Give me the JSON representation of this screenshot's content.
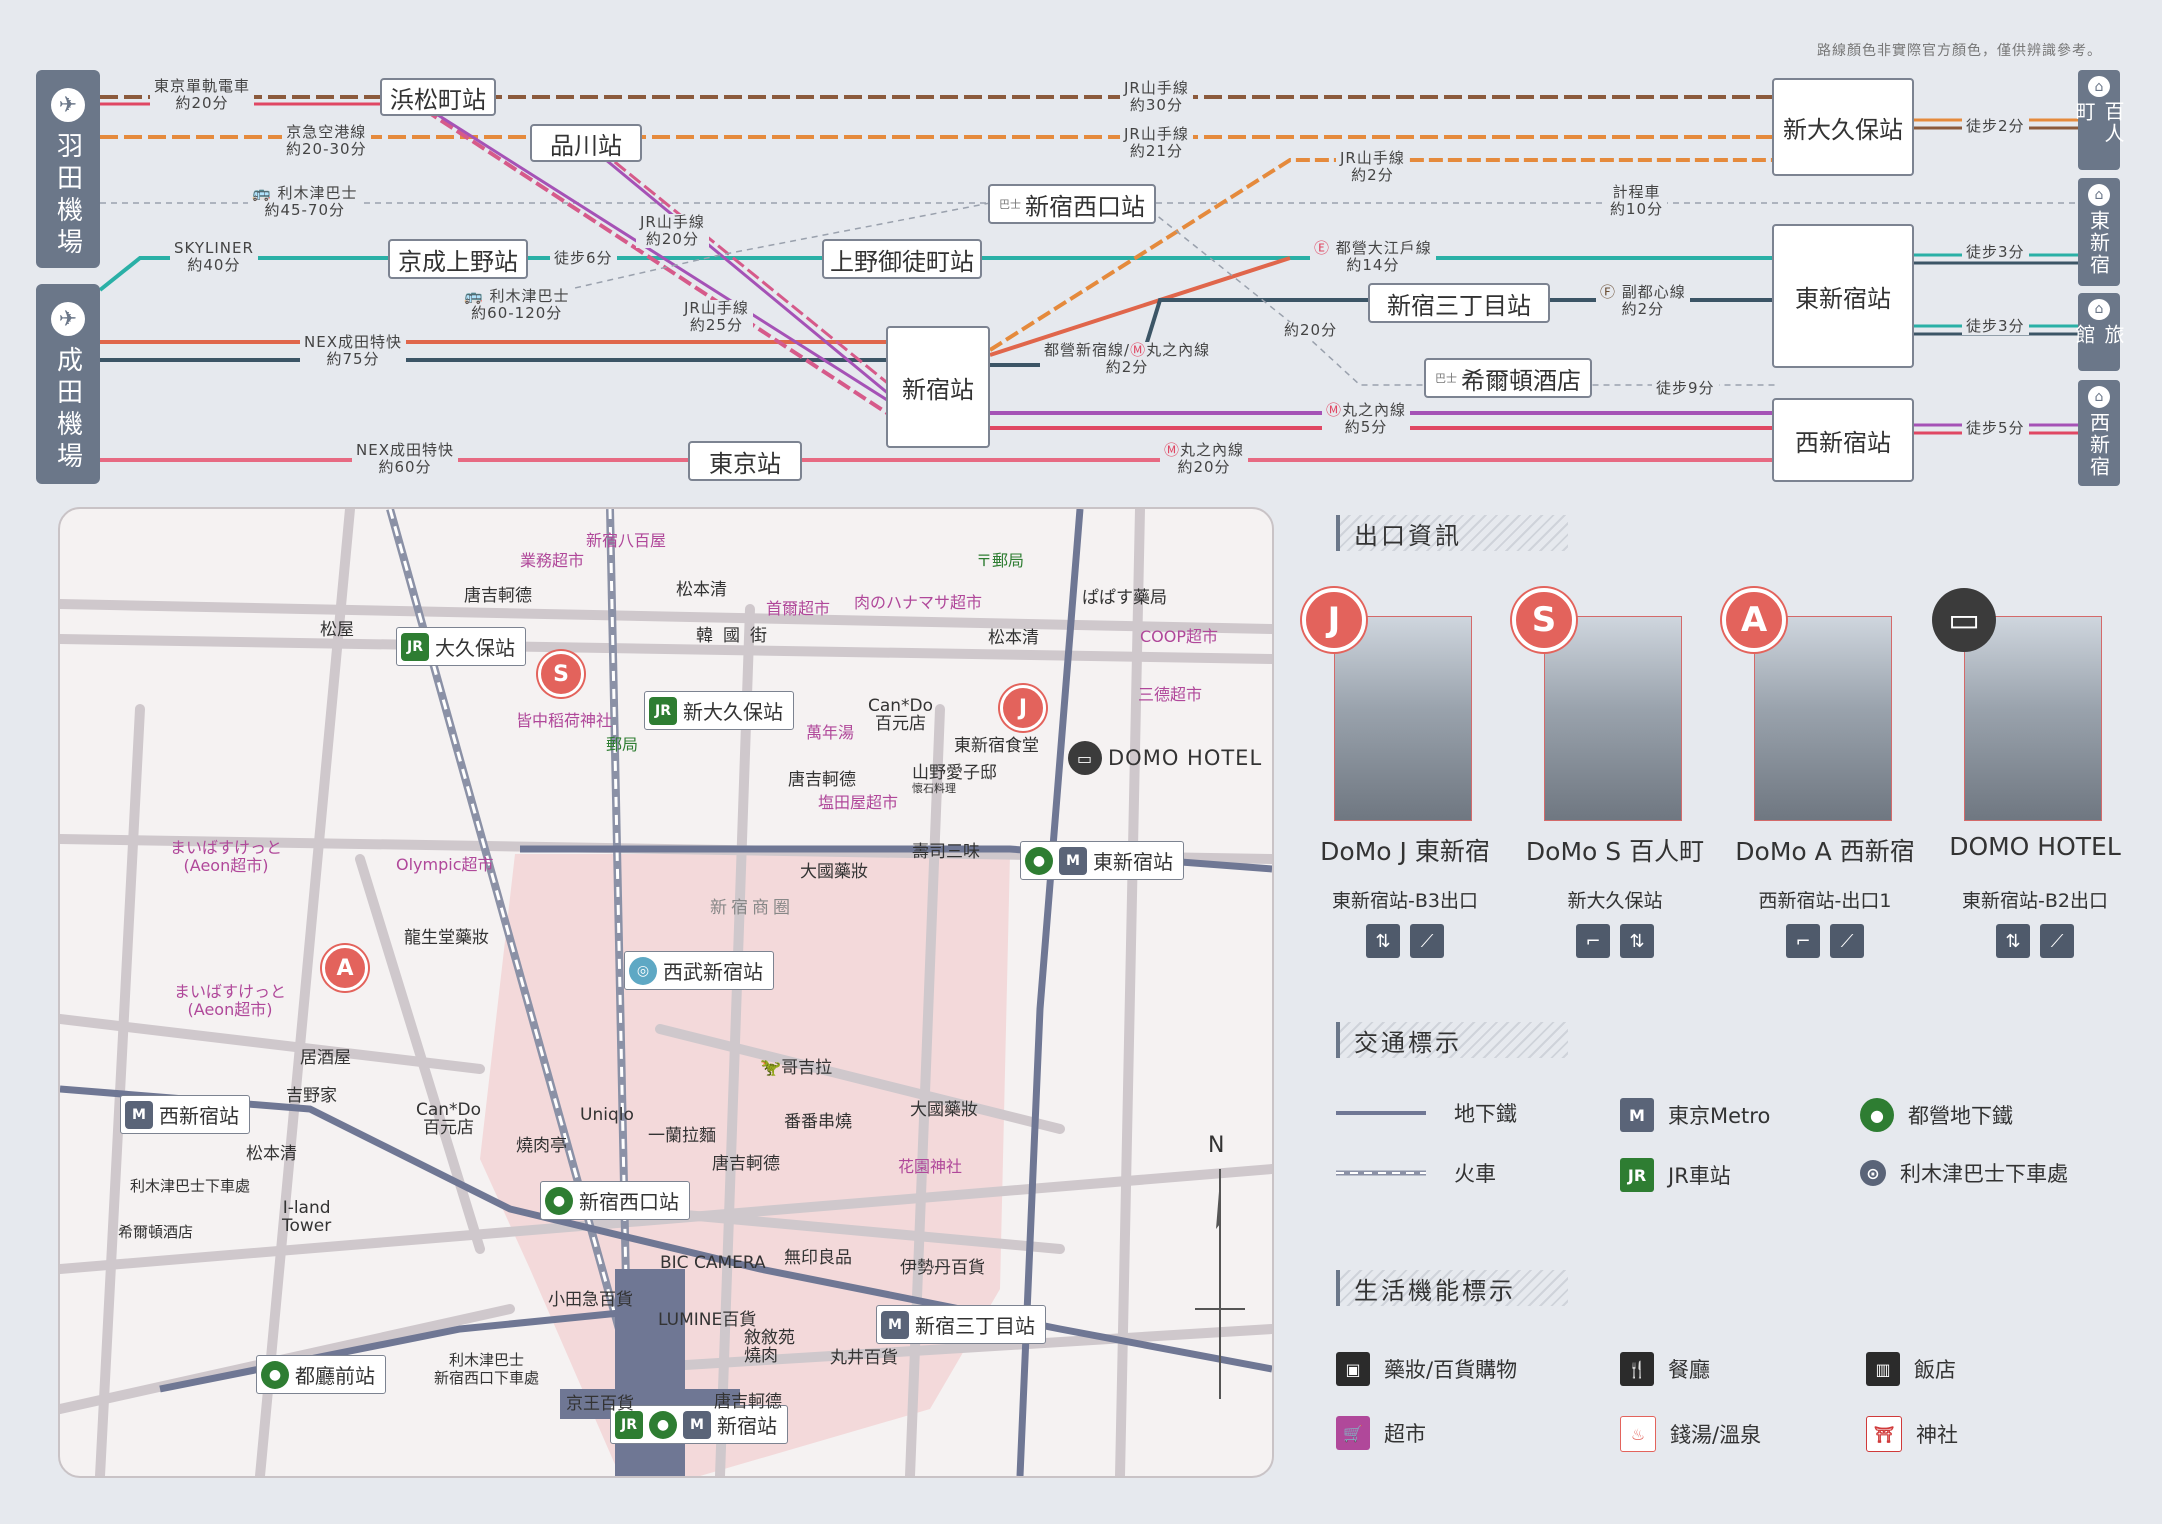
{
  "note": "路線顏色非實際官方顏色，僅供辨識參考。",
  "airports": [
    {
      "name": "羽田機場",
      "icon": "plane-icon"
    },
    {
      "name": "成田機場",
      "icon": "plane-icon"
    }
  ],
  "hotel_tags": [
    {
      "name": "百人町",
      "icon": "house-icon"
    },
    {
      "name": "東新宿",
      "icon": "house-icon"
    },
    {
      "name": "旅館",
      "icon": "house-icon"
    },
    {
      "name": "西新宿",
      "icon": "house-icon"
    }
  ],
  "route_stations": {
    "hamamatsucho": "浜松町站",
    "shinagawa": "品川站",
    "shinjuku_nishiguchi": "新宿西口站",
    "keisei_ueno": "京成上野站",
    "ueno_okachimachi": "上野御徒町站",
    "shinjuku": "新宿站",
    "tokyo": "東京站",
    "shinjuku_sanchome": "新宿三丁目站",
    "hilton": "希爾頓酒店",
    "shin_okubo": "新大久保站",
    "higashi_shinjuku": "東新宿站",
    "nishi_shinjuku": "西新宿站"
  },
  "route_labels": {
    "monorail": [
      "東京單軌電車",
      "約20分"
    ],
    "keikyu": [
      "京急空港線",
      "約20-30分"
    ],
    "limousine_haneda": [
      "利木津巴士",
      "約45-70分"
    ],
    "skyliner": [
      "SKYLINER",
      "約40分"
    ],
    "limousine_narita": [
      "利木津巴士",
      "約60-120分"
    ],
    "nex1": [
      "NEX成田特快",
      "約75分"
    ],
    "nex2": [
      "NEX成田特快",
      "約60分"
    ],
    "walk6": "徒步6分",
    "jr_yamanote_30": [
      "JR山手線",
      "約30分"
    ],
    "jr_yamanote_21": [
      "JR山手線",
      "約21分"
    ],
    "jr_yamanote_2": [
      "JR山手線",
      "約2分"
    ],
    "jr_yamanote_20": [
      "JR山手線",
      "約20分"
    ],
    "jr_yamanote_25": [
      "JR山手線",
      "約25分"
    ],
    "taxi": [
      "計程車",
      "約10分"
    ],
    "oedo14": [
      "都營大江戶線",
      "約14分"
    ],
    "fukutoshin": [
      "副都心線",
      "約2分"
    ],
    "oedo_marunouchi": [
      "都營新宿線/",
      "丸之內線",
      "約2分"
    ],
    "m20": "約20分",
    "walk9": "徒步9分",
    "marunouchi5": [
      "丸之內線",
      "約5分"
    ],
    "marunouchi20": [
      "丸之內線",
      "約20分"
    ],
    "walk2": "徒步2分",
    "walk3a": "徒步3分",
    "walk3b": "徒步3分",
    "walk5": "徒步5分",
    "bus_prefix": "巴士"
  },
  "map": {
    "stations": {
      "okubo": "大久保站",
      "shin_okubo": "新大久保站",
      "higashi_shinjuku": "東新宿站",
      "seibu_shinjuku": "西武新宿站",
      "nishi_shinjuku": "西新宿站",
      "shinjuku_nishiguchi": "新宿西口站",
      "shinjuku_sanchome": "新宿三丁目站",
      "tochomae": "都廳前站",
      "shinjuku": "新宿站"
    },
    "places": {
      "shinjuku_hachi": "新宿八百屋",
      "gyomu": "業務超市",
      "karayoshi1": "唐吉軻德",
      "matsumoto1": "松本清",
      "matsuya": "松屋",
      "kankokugai": "韓國街",
      "shuei": "首爾超市",
      "hanamasa": "肉のハナマサ超市",
      "papasu": "ぱぱす藥局",
      "yubin1": "郵局",
      "coop": "COOP超市",
      "matsumoto2": "松本清",
      "santoku": "三德超市",
      "kainaka": "皆中稻荷神社",
      "yubin2": "郵局",
      "mannen": "萬年湯",
      "cando1a": "Can*Do",
      "cando1b": "百元店",
      "higashi_shokudo": "東新宿食堂",
      "domo_hotel": "DOMO HOTEL",
      "karayoshi2": "唐吉軻德",
      "shioda": "塩田屋超市",
      "yamano_a": "山野愛子邸",
      "yamano_b": "懷石料理",
      "sushi": "壽司三味",
      "daikoku1": "大國藥妝",
      "aeon1a": "まいばすけっと",
      "aeon1b": "(Aeon超市)",
      "olympic": "Olympic超市",
      "ryusei": "龍生堂藥妝",
      "shotengai": "新宿商圈",
      "aeon2a": "まいばすけっと",
      "aeon2b": "(Aeon超市)",
      "izakaya": "居酒屋",
      "yoshinoya": "吉野家",
      "godzilla": "哥吉拉",
      "cando2a": "Can*Do",
      "cando2b": "百元店",
      "matsumoto3": "松本清",
      "uniqlo": "Uniqlo",
      "yakiniku": "燒肉亭",
      "ichiran": "一蘭拉麵",
      "banban": "番番串燒",
      "daikoku2": "大國藥妝",
      "karayoshi3": "唐吉軻德",
      "hanazono": "花園神社",
      "limo_nishi_a": "利木津巴士下車處",
      "hilton": "希爾頓酒店",
      "iland_a": "I-land",
      "iland_b": "Tower",
      "bic": "BIC CAMERA",
      "mujirushi": "無印良品",
      "isetan": "伊勢丹百貨",
      "odakyu": "小田急百貨",
      "lumine": "LUMINE百貨",
      "jojoen_a": "敘敘苑",
      "jojoen_b": "燒肉",
      "marui": "丸井百貨",
      "limo_shinjuku_a": "利木津巴士",
      "limo_shinjuku_b": "新宿西口下車處",
      "keio": "京王百貨",
      "karayoshi4": "唐吉軻德",
      "north": "N"
    }
  },
  "exits_section": {
    "title": "出口資訊",
    "hotels": [
      {
        "badge": "J",
        "name": "DoMo J 東新宿",
        "exit": "東新宿站-B3出口",
        "facilities": [
          "elevator-icon",
          "escalator-icon"
        ]
      },
      {
        "badge": "S",
        "name": "DoMo S 百人町",
        "exit": "新大久保站",
        "facilities": [
          "stairs-icon",
          "elevator-icon"
        ]
      },
      {
        "badge": "A",
        "name": "DoMo A 西新宿",
        "exit": "西新宿站-出口1",
        "facilities": [
          "stairs-icon",
          "escalator-icon"
        ]
      },
      {
        "badge": "bed",
        "name": "DOMO HOTEL",
        "exit": "東新宿站-B2出口",
        "facilities": [
          "elevator-icon",
          "escalator-icon"
        ]
      }
    ]
  },
  "transport_legend": {
    "title": "交通標示",
    "items": [
      {
        "label": "地下鐵",
        "icon": "subway-line-icon"
      },
      {
        "label": "東京Metro",
        "icon": "tokyo-metro-icon"
      },
      {
        "label": "都營地下鐵",
        "icon": "toei-subway-icon"
      },
      {
        "label": "火車",
        "icon": "train-line-icon"
      },
      {
        "label": "JR車站",
        "icon": "jr-station-icon"
      },
      {
        "label": "利木津巴士下車處",
        "icon": "bus-stop-icon"
      }
    ]
  },
  "life_legend": {
    "title": "生活機能標示",
    "items": [
      {
        "label": "藥妝/百貨購物",
        "icon": "shopping-bag-icon"
      },
      {
        "label": "餐廳",
        "icon": "restaurant-icon"
      },
      {
        "label": "飯店",
        "icon": "hotel-building-icon"
      },
      {
        "label": "超市",
        "icon": "cart-icon"
      },
      {
        "label": "錢湯/溫泉",
        "icon": "onsen-icon"
      },
      {
        "label": "神社",
        "icon": "shrine-icon"
      }
    ]
  },
  "colors": {
    "monorail": "#8b5a3c",
    "keikyu": "#e58a3c",
    "skyliner": "#2ab0a6",
    "nex": "#e0664b",
    "nex_dark": "#3c5566",
    "narita_nex2": "#e76a82",
    "oedo": "#d65a8a",
    "fukutoshin": "#6b4f35",
    "marunouchi": "#e04763",
    "shinjuku_line": "#a552b6",
    "subway_gray": "#4f5a6b",
    "hotel_red": "#e3635c"
  }
}
